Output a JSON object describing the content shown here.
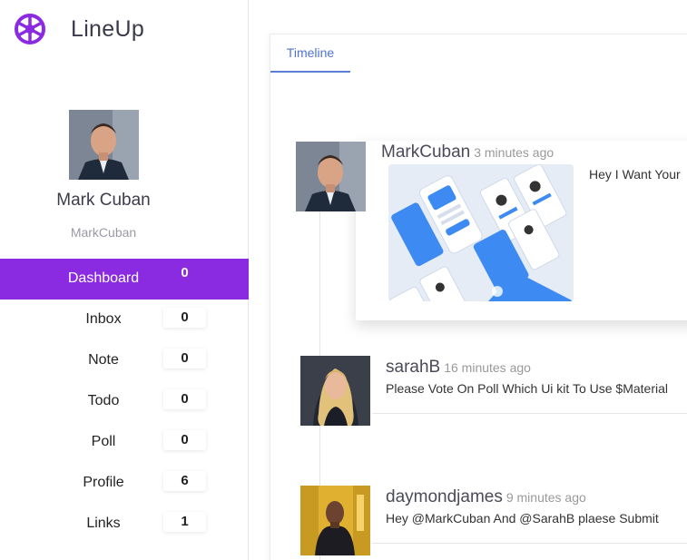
{
  "app": {
    "name": "LineUp",
    "logo_icon": "hub-icon",
    "accent": "#8a2be2"
  },
  "profile": {
    "name": "Mark Cuban",
    "handle": "MarkCuban"
  },
  "nav": {
    "items": [
      {
        "label": "Dashboard",
        "count": "0",
        "active": true
      },
      {
        "label": "Inbox",
        "count": "0"
      },
      {
        "label": "Note",
        "count": "0"
      },
      {
        "label": "Todo",
        "count": "0"
      },
      {
        "label": "Poll",
        "count": "0"
      },
      {
        "label": "Profile",
        "count": "6"
      },
      {
        "label": "Links",
        "count": "1"
      }
    ]
  },
  "tabs": [
    {
      "label": "Timeline",
      "active": true
    }
  ],
  "posts": [
    {
      "user": "MarkCuban",
      "time": "3 minutes ago",
      "text": "Hey I Want Your",
      "has_image": true
    },
    {
      "user": "sarahB",
      "time": "16 minutes ago",
      "text": "Please Vote On Poll Which Ui kit To Use $Material"
    },
    {
      "user": "daymondjames",
      "time": "9 minutes ago",
      "text": "Hey @MarkCuban And @SarahB plaese Submit"
    }
  ]
}
